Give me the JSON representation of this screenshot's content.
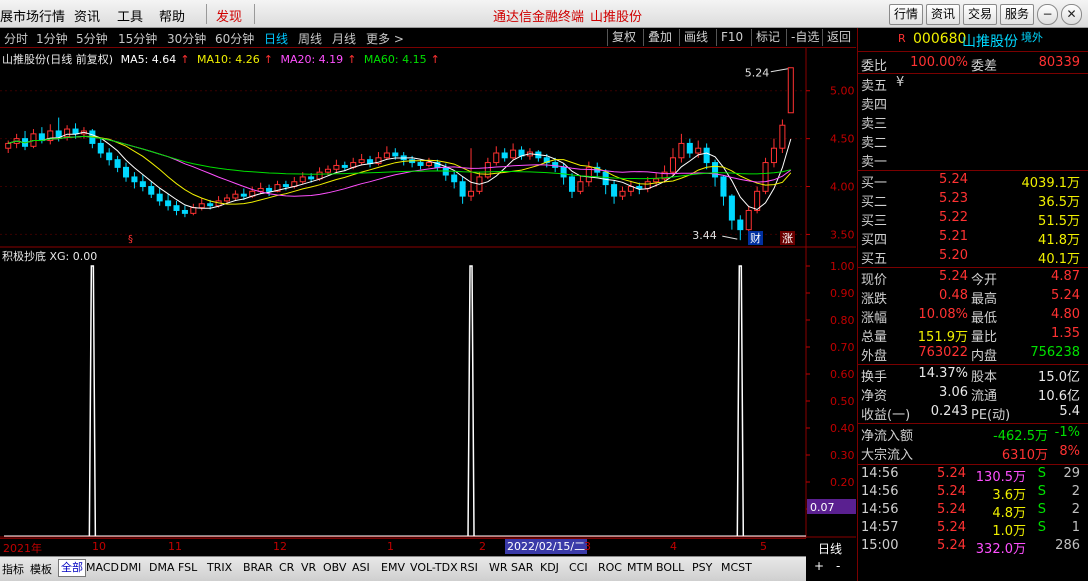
{
  "menu": {
    "items": [
      "展市场行情",
      "资讯",
      "工具",
      "帮助"
    ],
    "active_item": "发现",
    "center_title": "通达信金融终端",
    "center_stock": "山推股份",
    "buttons": [
      "行情",
      "资讯",
      "交易",
      "服务"
    ]
  },
  "periods": {
    "items": [
      "分时",
      "1分钟",
      "5分钟",
      "15分钟",
      "30分钟",
      "60分钟",
      "日线",
      "周线",
      "月线",
      "更多 >"
    ],
    "active": "日线"
  },
  "toolbar": {
    "items": [
      "复权",
      "叠加",
      "画线",
      "F10",
      "标记",
      "-自选",
      "返回"
    ]
  },
  "main_chart": {
    "title": "山推股份(日线 前复权)",
    "ma": [
      {
        "label": "MA5: 4.64",
        "color": "#ffffff"
      },
      {
        "label": "MA10: 4.26",
        "color": "#f0f000"
      },
      {
        "label": "MA20: 4.19",
        "color": "#ff50ff"
      },
      {
        "label": "MA60: 4.15",
        "color": "#00e000"
      }
    ],
    "ylim": [
      3.4,
      5.3
    ],
    "y_ticks": [
      "5.00",
      "4.50",
      "4.00",
      "3.50"
    ],
    "high_label": "5.24",
    "low_label": "3.44",
    "marks": {
      "s_mark": "§",
      "cai": "财",
      "zhang": "涨"
    },
    "candles": [
      [
        4.4,
        4.45,
        4.35,
        4.48
      ],
      [
        4.45,
        4.5,
        4.4,
        4.55
      ],
      [
        4.5,
        4.42,
        4.38,
        4.58
      ],
      [
        4.42,
        4.55,
        4.4,
        4.6
      ],
      [
        4.55,
        4.48,
        4.45,
        4.62
      ],
      [
        4.48,
        4.58,
        4.44,
        4.65
      ],
      [
        4.58,
        4.52,
        4.47,
        4.72
      ],
      [
        4.52,
        4.6,
        4.48,
        4.64
      ],
      [
        4.6,
        4.55,
        4.5,
        4.66
      ],
      [
        4.55,
        4.58,
        4.5,
        4.62
      ],
      [
        4.58,
        4.45,
        4.4,
        4.6
      ],
      [
        4.45,
        4.35,
        4.3,
        4.5
      ],
      [
        4.35,
        4.28,
        4.22,
        4.4
      ],
      [
        4.28,
        4.2,
        4.15,
        4.32
      ],
      [
        4.2,
        4.1,
        4.05,
        4.25
      ],
      [
        4.1,
        4.05,
        3.98,
        4.15
      ],
      [
        4.05,
        4.0,
        3.95,
        4.12
      ],
      [
        4.0,
        3.92,
        3.88,
        4.05
      ],
      [
        3.92,
        3.85,
        3.8,
        3.98
      ],
      [
        3.85,
        3.8,
        3.75,
        3.92
      ],
      [
        3.8,
        3.75,
        3.7,
        3.85
      ],
      [
        3.75,
        3.72,
        3.68,
        3.8
      ],
      [
        3.72,
        3.78,
        3.7,
        3.82
      ],
      [
        3.78,
        3.82,
        3.75,
        3.88
      ],
      [
        3.82,
        3.8,
        3.76,
        3.86
      ],
      [
        3.8,
        3.85,
        3.78,
        3.9
      ],
      [
        3.85,
        3.88,
        3.82,
        3.92
      ],
      [
        3.88,
        3.92,
        3.85,
        3.96
      ],
      [
        3.92,
        3.9,
        3.86,
        3.98
      ],
      [
        3.9,
        3.95,
        3.88,
        4.0
      ],
      [
        3.95,
        3.98,
        3.92,
        4.04
      ],
      [
        3.98,
        3.95,
        3.9,
        4.02
      ],
      [
        3.95,
        4.02,
        3.94,
        4.06
      ],
      [
        4.02,
        4.0,
        3.96,
        4.06
      ],
      [
        4.0,
        4.05,
        3.98,
        4.1
      ],
      [
        4.05,
        4.1,
        4.02,
        4.15
      ],
      [
        4.1,
        4.08,
        4.04,
        4.14
      ],
      [
        4.08,
        4.15,
        4.06,
        4.2
      ],
      [
        4.15,
        4.18,
        4.12,
        4.22
      ],
      [
        4.18,
        4.22,
        4.14,
        4.28
      ],
      [
        4.22,
        4.2,
        4.16,
        4.26
      ],
      [
        4.2,
        4.25,
        4.18,
        4.3
      ],
      [
        4.25,
        4.28,
        4.22,
        4.34
      ],
      [
        4.28,
        4.24,
        4.2,
        4.32
      ],
      [
        4.24,
        4.3,
        4.22,
        4.36
      ],
      [
        4.3,
        4.35,
        4.28,
        4.42
      ],
      [
        4.35,
        4.32,
        4.28,
        4.4
      ],
      [
        4.32,
        4.28,
        4.22,
        4.36
      ],
      [
        4.28,
        4.25,
        4.2,
        4.32
      ],
      [
        4.25,
        4.22,
        4.18,
        4.28
      ],
      [
        4.22,
        4.25,
        4.2,
        4.3
      ],
      [
        4.25,
        4.2,
        4.16,
        4.28
      ],
      [
        4.2,
        4.12,
        4.06,
        4.24
      ],
      [
        4.12,
        4.05,
        3.98,
        4.16
      ],
      [
        4.05,
        3.9,
        3.82,
        4.1
      ],
      [
        3.9,
        3.95,
        3.85,
        4.4
      ],
      [
        3.95,
        4.1,
        3.92,
        4.15
      ],
      [
        4.1,
        4.25,
        4.08,
        4.3
      ],
      [
        4.25,
        4.35,
        4.22,
        4.42
      ],
      [
        4.35,
        4.3,
        4.26,
        4.4
      ],
      [
        4.3,
        4.38,
        4.28,
        4.45
      ],
      [
        4.38,
        4.32,
        4.28,
        4.42
      ],
      [
        4.32,
        4.36,
        4.28,
        4.4
      ],
      [
        4.36,
        4.3,
        4.26,
        4.38
      ],
      [
        4.3,
        4.25,
        4.2,
        4.34
      ],
      [
        4.25,
        4.2,
        4.15,
        4.3
      ],
      [
        4.2,
        4.1,
        4.02,
        4.24
      ],
      [
        4.1,
        3.95,
        3.88,
        4.14
      ],
      [
        3.95,
        4.05,
        3.92,
        4.12
      ],
      [
        4.05,
        4.2,
        4.0,
        4.26
      ],
      [
        4.2,
        4.15,
        4.1,
        4.25
      ],
      [
        4.15,
        4.02,
        3.92,
        4.18
      ],
      [
        4.02,
        3.9,
        3.82,
        4.06
      ],
      [
        3.9,
        3.95,
        3.86,
        4.0
      ],
      [
        3.95,
        4.0,
        3.9,
        4.06
      ],
      [
        4.0,
        3.98,
        3.92,
        4.04
      ],
      [
        3.98,
        4.05,
        3.94,
        4.1
      ],
      [
        4.05,
        4.08,
        4.0,
        4.14
      ],
      [
        4.08,
        4.15,
        4.04,
        4.22
      ],
      [
        4.15,
        4.3,
        4.12,
        4.4
      ],
      [
        4.3,
        4.45,
        4.25,
        4.55
      ],
      [
        4.45,
        4.35,
        4.3,
        4.5
      ],
      [
        4.35,
        4.4,
        4.3,
        4.48
      ],
      [
        4.4,
        4.25,
        4.18,
        4.45
      ],
      [
        4.25,
        4.1,
        4.0,
        4.28
      ],
      [
        4.1,
        3.9,
        3.8,
        4.12
      ],
      [
        3.9,
        3.65,
        3.55,
        3.92
      ],
      [
        3.65,
        3.55,
        3.44,
        3.7
      ],
      [
        3.55,
        3.75,
        3.52,
        3.8
      ],
      [
        3.75,
        3.95,
        3.72,
        4.0
      ],
      [
        3.95,
        4.25,
        3.92,
        4.3
      ],
      [
        4.25,
        4.4,
        4.2,
        4.5
      ],
      [
        4.4,
        4.64,
        4.35,
        4.7
      ],
      [
        4.77,
        5.24,
        4.77,
        5.24
      ]
    ]
  },
  "indicator": {
    "title": "积极抄底 XG: 0.00",
    "ylim": [
      0,
      1
    ],
    "y_ticks": [
      "1.00",
      "0.90",
      "0.80",
      "0.70",
      "0.60",
      "0.50",
      "0.40",
      "0.30",
      "0.20",
      "0.10"
    ],
    "current_value": "0.07",
    "signals": [
      {
        "index": 10,
        "value": 1.0
      },
      {
        "index": 55,
        "value": 1.0
      },
      {
        "index": 87,
        "value": 1.0
      }
    ]
  },
  "date_axis": {
    "labels": [
      "2021年",
      "10",
      "11",
      "12",
      "1",
      "2",
      "3",
      "4",
      "5"
    ],
    "cursor_date": "2022/02/15/二",
    "period_label": "日线"
  },
  "indicator_tabs": {
    "items": [
      "指标",
      "模板",
      "全部",
      "MACD",
      "DMI",
      "DMA",
      "FSL",
      "TRIX",
      "BRAR",
      "CR",
      "VR",
      "OBV",
      "ASI",
      "EMV",
      "VOL-TDX",
      "RSI",
      "WR",
      "SAR",
      "KDJ",
      "CCI",
      "ROC",
      "MTM",
      "BOLL",
      "PSY",
      "MCST"
    ],
    "active": "全部",
    "extra": [
      "+",
      "-"
    ]
  },
  "quote": {
    "flag": "R",
    "code": "000680",
    "name": "山推股份",
    "tag": "境外",
    "weibi_label": "委比",
    "weibi": "100.00%",
    "weicha_label": "委差",
    "weicha": "80339",
    "sell": [
      {
        "label": "卖五",
        "price": "¥",
        "vol": ""
      },
      {
        "label": "卖四",
        "price": "",
        "vol": ""
      },
      {
        "label": "卖三",
        "price": "",
        "vol": ""
      },
      {
        "label": "卖二",
        "price": "",
        "vol": ""
      },
      {
        "label": "卖一",
        "price": "",
        "vol": ""
      }
    ],
    "buy": [
      {
        "label": "买一",
        "price": "5.24",
        "vol": "4039.1万"
      },
      {
        "label": "买二",
        "price": "5.23",
        "vol": "36.5万"
      },
      {
        "label": "买三",
        "price": "5.22",
        "vol": "51.5万"
      },
      {
        "label": "买四",
        "price": "5.21",
        "vol": "41.8万"
      },
      {
        "label": "买五",
        "price": "5.20",
        "vol": "40.1万"
      }
    ],
    "stats": [
      {
        "l1": "现价",
        "v1": "5.24",
        "c1": "red",
        "l2": "今开",
        "v2": "4.87",
        "c2": "red"
      },
      {
        "l1": "涨跌",
        "v1": "0.48",
        "c1": "red",
        "l2": "最高",
        "v2": "5.24",
        "c2": "red"
      },
      {
        "l1": "涨幅",
        "v1": "10.08%",
        "c1": "red",
        "l2": "最低",
        "v2": "4.80",
        "c2": "red"
      },
      {
        "l1": "总量",
        "v1": "151.9万",
        "c1": "yellow",
        "l2": "量比",
        "v2": "1.35",
        "c2": "red"
      },
      {
        "l1": "外盘",
        "v1": "763022",
        "c1": "red",
        "l2": "内盘",
        "v2": "756238",
        "c2": "green"
      }
    ],
    "stats2": [
      {
        "l1": "换手",
        "v1": "14.37%",
        "c1": "white",
        "l2": "股本",
        "v2": "15.0亿",
        "c2": "white"
      },
      {
        "l1": "净资",
        "v1": "3.06",
        "c1": "white",
        "l2": "流通",
        "v2": "10.6亿",
        "c2": "white"
      },
      {
        "l1": "收益(一)",
        "v1": "0.243",
        "c1": "white",
        "l2": "PE(动)",
        "v2": "5.4",
        "c2": "white"
      }
    ],
    "flows": [
      {
        "label": "净流入额",
        "value": "-462.5万",
        "pct": "-1%",
        "color": "green"
      },
      {
        "label": "大宗流入",
        "value": "6310万",
        "pct": "8%",
        "color": "red"
      }
    ],
    "ticks": [
      {
        "time": "14:56",
        "price": "5.24",
        "vol": "130.5万",
        "vc": "magenta",
        "side": "S",
        "n": "29"
      },
      {
        "time": "14:56",
        "price": "5.24",
        "vol": "3.6万",
        "vc": "yellow",
        "side": "S",
        "n": "2"
      },
      {
        "time": "14:56",
        "price": "5.24",
        "vol": "4.8万",
        "vc": "yellow",
        "side": "S",
        "n": "2"
      },
      {
        "time": "14:57",
        "price": "5.24",
        "vol": "1.0万",
        "vc": "yellow",
        "side": "S",
        "n": "1"
      },
      {
        "time": "15:00",
        "price": "5.24",
        "vol": "332.0万",
        "vc": "magenta",
        "side": "",
        "n": "286"
      }
    ]
  }
}
